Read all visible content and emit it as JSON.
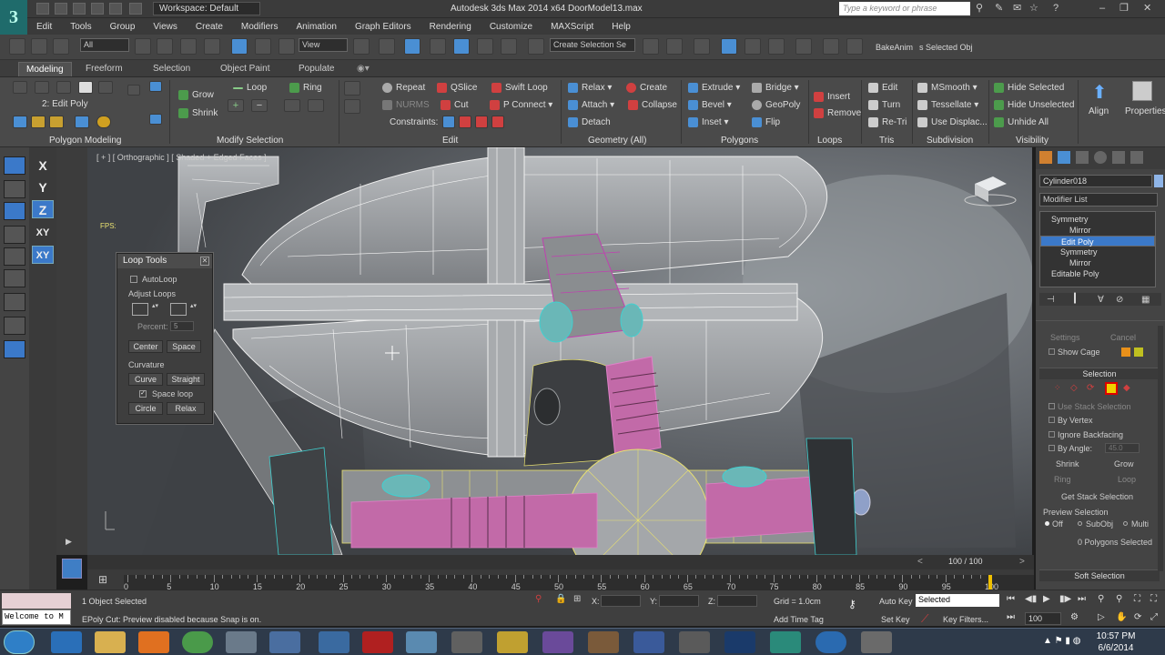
{
  "title": {
    "workspace": "Workspace: Default",
    "app": "Autodesk 3ds Max  2014 x64     DoorModel13.max",
    "search_placeholder": "Type a keyword or phrase"
  },
  "menu": [
    "Edit",
    "Tools",
    "Group",
    "Views",
    "Create",
    "Modifiers",
    "Animation",
    "Graph Editors",
    "Rendering",
    "Customize",
    "MAXScript",
    "Help"
  ],
  "toolbar": {
    "selection_filter": "All",
    "ref_coord": "View",
    "named_sel": "Create Selection Se",
    "bake_anim": "BakeAnim",
    "selected_obj": "s Selected Obj"
  },
  "ribbon_tabs": [
    "Modeling",
    "Freeform",
    "Selection",
    "Object Paint",
    "Populate"
  ],
  "ribbon": {
    "mod_name": "2: Edit Poly",
    "groups": [
      "Polygon Modeling",
      "Modify Selection",
      "Edit",
      "Geometry (All)",
      "Polygons",
      "Loops",
      "Tris",
      "Subdivision",
      "Visibility"
    ],
    "modify": [
      "Grow",
      "Shrink",
      "Loop",
      "Ring"
    ],
    "edit": [
      "Repeat",
      "QSlice",
      "Swift Loop",
      "NURMS",
      "Cut",
      "P Connect",
      "Constraints:"
    ],
    "geometry": [
      "Relax",
      "Create",
      "Attach",
      "Collapse",
      "Detach"
    ],
    "polygons": [
      "Extrude",
      "Bridge",
      "Bevel",
      "GeoPoly",
      "Inset",
      "Flip"
    ],
    "loops": [
      "Insert",
      "Remove"
    ],
    "tris": [
      "Edit",
      "Turn",
      "Re-Tri"
    ],
    "subdivision": [
      "MSmooth",
      "Tessellate",
      "Use Displac..."
    ],
    "visibility": [
      "Hide Selected",
      "Hide Unselected",
      "Unhide All"
    ],
    "align": "Align",
    "properties": "Properties"
  },
  "axes": [
    "X",
    "Y",
    "Z",
    "XY",
    "XY"
  ],
  "viewport": {
    "label": "[ + ] [ Orthographic ] [ Shaded + Edged Faces ]",
    "fps": "FPS:"
  },
  "loop_tools": {
    "title": "Loop Tools",
    "autoloop": "AutoLoop",
    "adjust_loops": "Adjust Loops",
    "percent_label": "Percent:",
    "percent_value": "5",
    "center": "Center",
    "space": "Space",
    "curvature": "Curvature",
    "curve": "Curve",
    "straight": "Straight",
    "space_loop": "Space loop",
    "circle": "Circle",
    "relax": "Relax"
  },
  "command_panel": {
    "object_name": "Cylinder018",
    "modifier_list": "Modifier List",
    "stack": [
      {
        "label": "Symmetry",
        "indent": 1
      },
      {
        "label": "Mirror",
        "indent": 3
      },
      {
        "label": "Edit Poly",
        "indent": 1,
        "selected": true
      },
      {
        "label": "Symmetry",
        "indent": 1
      },
      {
        "label": "Mirror",
        "indent": 3
      },
      {
        "label": "Editable Poly",
        "indent": 1
      }
    ],
    "settings": "Settings",
    "cancel": "Cancel",
    "show_cage": "Show Cage",
    "selection": "Selection",
    "use_stack_selection": "Use Stack Selection",
    "by_vertex": "By Vertex",
    "ignore_backfacing": "Ignore Backfacing",
    "by_angle": "By Angle:",
    "by_angle_value": "45.0",
    "shrink": "Shrink",
    "grow": "Grow",
    "ring": "Ring",
    "loop": "Loop",
    "get_stack_selection": "Get Stack Selection",
    "preview_selection": "Preview Selection",
    "preview_off": "Off",
    "preview_subobj": "SubObj",
    "preview_multi": "Multi",
    "polygons_selected": "0 Polygons Selected",
    "soft_selection": "Soft Selection"
  },
  "timeline": {
    "frame": "100 / 100",
    "ticks": [
      "0",
      "5",
      "10",
      "15",
      "20",
      "25",
      "30",
      "35",
      "40",
      "45",
      "50",
      "55",
      "60",
      "65",
      "70",
      "75",
      "80",
      "85",
      "90",
      "95",
      "100"
    ]
  },
  "status": {
    "welcome": "Welcome to M",
    "objects_selected": "1 Object Selected",
    "prompt": "EPoly Cut: Preview disabled because Snap is on.",
    "x": "X:",
    "y": "Y:",
    "z": "Z:",
    "grid": "Grid = 1.0cm",
    "add_time_tag": "Add Time Tag",
    "auto_key": "Auto Key",
    "set_key": "Set Key",
    "key_filters": "Key Filters...",
    "key_mode": "Selected",
    "current_frame": "100"
  },
  "clock": {
    "time": "10:57 PM",
    "date": "6/6/2014"
  },
  "colors": {
    "accent": "#3b79c9",
    "wire_pink": "#c040b0",
    "wire_yellow": "#e8e070",
    "wire_cyan": "#40d0d0"
  }
}
